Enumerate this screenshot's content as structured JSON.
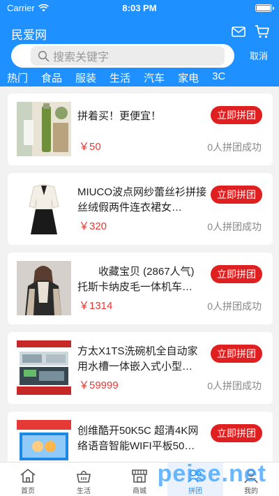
{
  "status": {
    "carrier": "Carrier",
    "time": "8:03 PM"
  },
  "header": {
    "title": "民爱网",
    "search_placeholder": "搜索关键字",
    "cancel": "取消"
  },
  "categories": [
    "热门",
    "食品",
    "服装",
    "生活",
    "汽车",
    "家电",
    "3C"
  ],
  "products": [
    {
      "name": "拼着买！更便宜！",
      "price": "￥50",
      "button": "立即拼团",
      "success": "0人拼团成功"
    },
    {
      "name": "MIUCO波点网纱蕾丝衫拼接丝绒假两件连衣裙女…",
      "price": "￥320",
      "button": "立即拼团",
      "success": "0人拼团成功"
    },
    {
      "name": "收藏宝贝 (2867人气) 托斯卡纳皮毛一体机车…",
      "price": "￥1314",
      "button": "立即拼团",
      "success": "0人拼团成功"
    },
    {
      "name": "方太X1TS洗碗机全自动家用水槽一体嵌入式小型…",
      "price": "￥59999",
      "button": "立即拼团",
      "success": "0人拼团成功"
    },
    {
      "name": "创维酷开50K5C 超清4K网络语音智能WIFI平板50…",
      "price": "",
      "button": "立即拼团",
      "success": ""
    }
  ],
  "tabs": [
    {
      "label": "首页",
      "icon": "home-icon"
    },
    {
      "label": "生活",
      "icon": "basket-icon"
    },
    {
      "label": "商城",
      "icon": "store-icon"
    },
    {
      "label": "拼团",
      "icon": "group-buy-icon"
    },
    {
      "label": "我的",
      "icon": "profile-icon"
    }
  ],
  "watermark": "peise.net",
  "colors": {
    "primary": "#1e90ff",
    "button": "#e02020",
    "price": "#e53935"
  }
}
